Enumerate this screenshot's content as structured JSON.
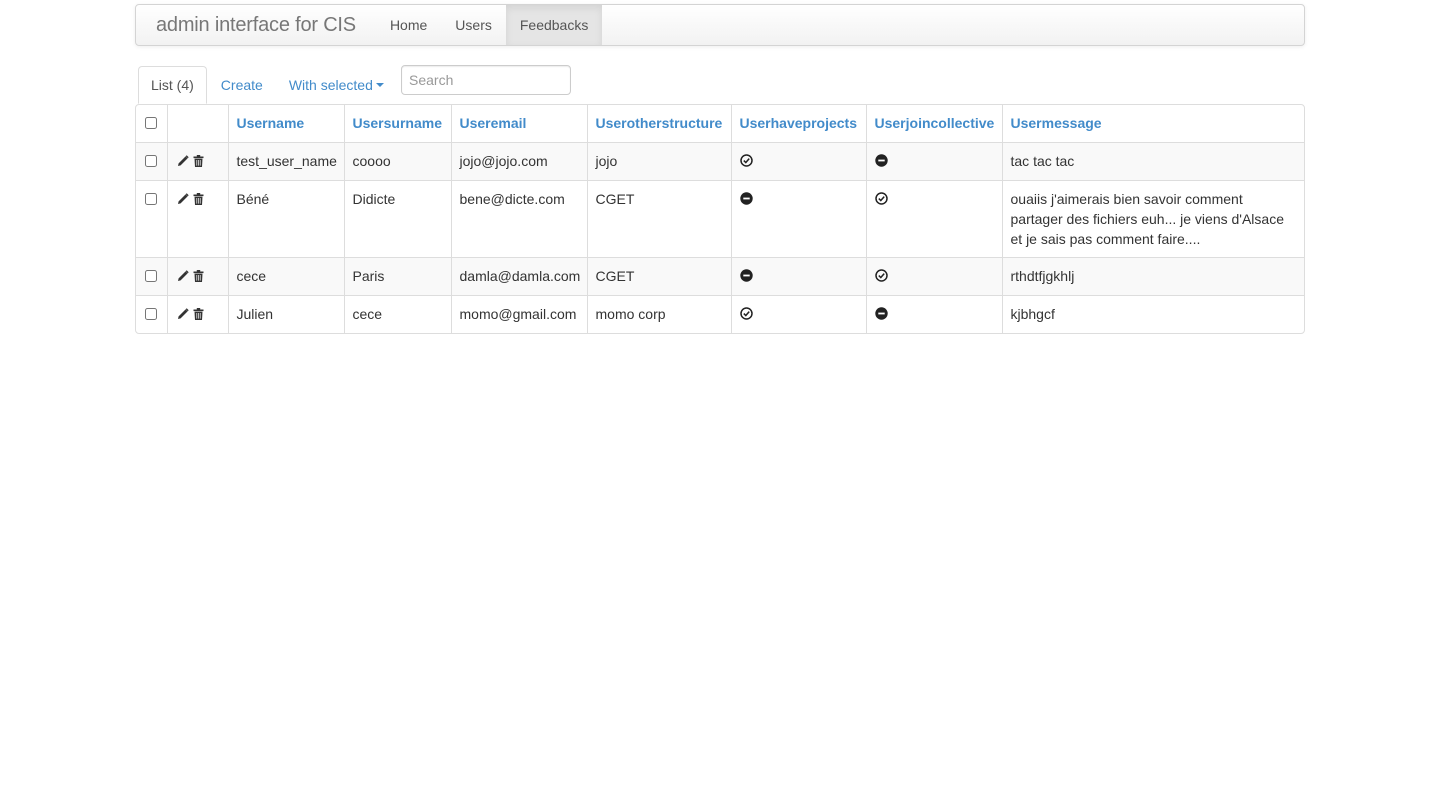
{
  "navbar": {
    "brand": "admin interface for CIS",
    "links": [
      {
        "label": "Home"
      },
      {
        "label": "Users"
      },
      {
        "label": "Feedbacks"
      }
    ]
  },
  "tabs": {
    "list": "List (4)",
    "create": "Create",
    "with_selected": "With selected"
  },
  "search": {
    "placeholder": "Search",
    "value": ""
  },
  "table": {
    "columns": [
      "Username",
      "Usersurname",
      "Useremail",
      "Userotherstructure",
      "Userhaveprojects",
      "Userjoincollective",
      "Usermessage"
    ],
    "rows": [
      {
        "username": "test_user_name",
        "usersurname": "coooo",
        "useremail": "jojo@jojo.com",
        "userotherstructure": "jojo",
        "userhaveprojects": "ok-circle-icon",
        "userjoincollective": "minus-sign-icon",
        "usermessage": "tac tac tac"
      },
      {
        "username": "Béné",
        "usersurname": "Didicte",
        "useremail": "bene@dicte.com",
        "userotherstructure": "CGET",
        "userhaveprojects": "minus-sign-icon",
        "userjoincollective": "ok-circle-icon",
        "usermessage": "ouaiis j'aimerais bien savoir comment partager des fichiers euh... je viens d'Alsace et je sais pas comment faire...."
      },
      {
        "username": "cece",
        "usersurname": "Paris",
        "useremail": "damla@damla.com",
        "userotherstructure": "CGET",
        "userhaveprojects": "minus-sign-icon",
        "userjoincollective": "ok-circle-icon",
        "usermessage": "rthdtfjgkhlj"
      },
      {
        "username": "Julien",
        "usersurname": "cece",
        "useremail": "momo@gmail.com",
        "userotherstructure": "momo corp",
        "userhaveprojects": "ok-circle-icon",
        "userjoincollective": "minus-sign-icon",
        "usermessage": "kjbhgcf"
      }
    ]
  }
}
